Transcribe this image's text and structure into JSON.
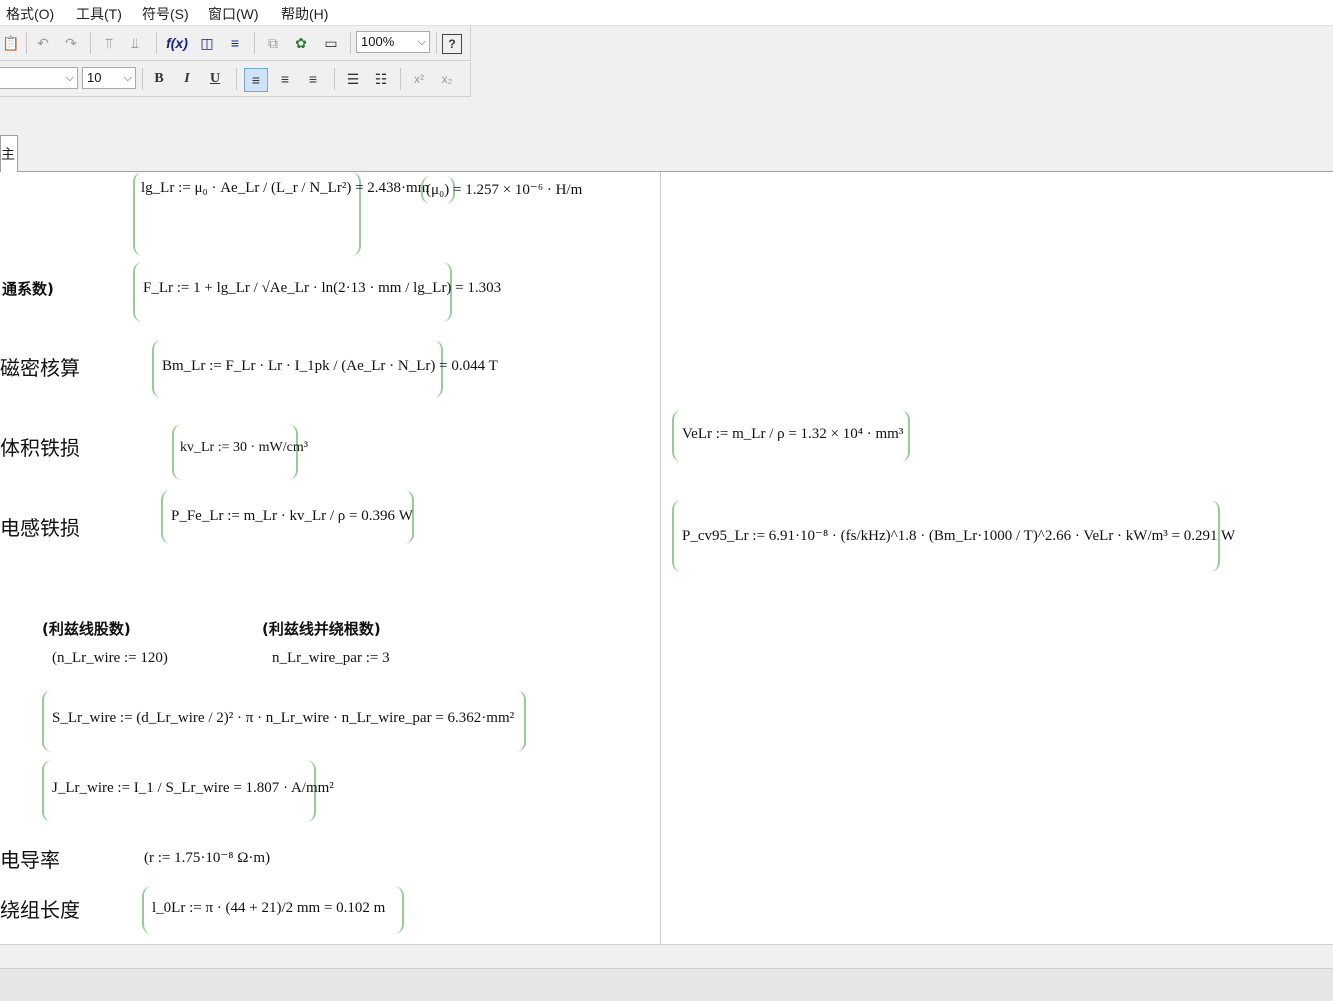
{
  "menu": [
    "格式(O)",
    "工具(T)",
    "符号(S)",
    "窗口(W)",
    "帮助(H)"
  ],
  "toolbar1": {
    "zoom": "100%"
  },
  "toolbar2": {
    "font_size": "10",
    "bold": "B",
    "italic": "I",
    "underline": "U"
  },
  "tab": {
    "label": "主"
  },
  "worksheet": {
    "lg_expr": "lg_Lr := μ₀ · Ae_Lr / (L_r / N_Lr²) = 2.438·mm",
    "mu0_expr": "(μ₀) = 1.257 × 10⁻⁶ · H/m",
    "f_label": "通系数)",
    "f_expr": "F_Lr := 1 + lg_Lr / √Ae_Lr · ln(2·13 · mm / lg_Lr) = 1.303",
    "bm_label": "磁密核算",
    "bm_expr": "Bm_Lr := F_Lr · Lr · I_1pk / (Ae_Lr · N_Lr) = 0.044 T",
    "kv_label": "体积铁损",
    "kv_expr": "kv_Lr := 30 · mW/cm³",
    "velr_expr": "VeLr := m_Lr / ρ = 1.32 × 10⁴ · mm³",
    "pfe_label": "电感铁损",
    "pfe_expr": "P_Fe_Lr := m_Lr · kv_Lr / ρ = 0.396 W",
    "pcv_expr": "P_cv95_Lr := 6.91·10⁻⁸ · (fs/kHz)^1.8 · (Bm_Lr·1000 / T)^2.66 · VeLr · kW/m³ = 0.291 W",
    "wire_count_hdr": "(利兹线股数)",
    "wire_par_hdr": "(利兹线并绕根数)",
    "n_wire_expr": "(n_Lr_wire := 120)",
    "n_par_expr": "n_Lr_wire_par := 3",
    "s_expr": "S_Lr_wire := (d_Lr_wire / 2)² · π · n_Lr_wire · n_Lr_wire_par = 6.362·mm²",
    "j_expr": "J_Lr_wire := I_1 / S_Lr_wire = 1.807 · A/mm²",
    "r_label": "电导率",
    "r_expr": "(r := 1.75·10⁻⁸ Ω·m)",
    "l_label": "绕组长度",
    "l_expr": "l_0Lr := π · (44 + 21)/2 mm = 0.102 m"
  }
}
